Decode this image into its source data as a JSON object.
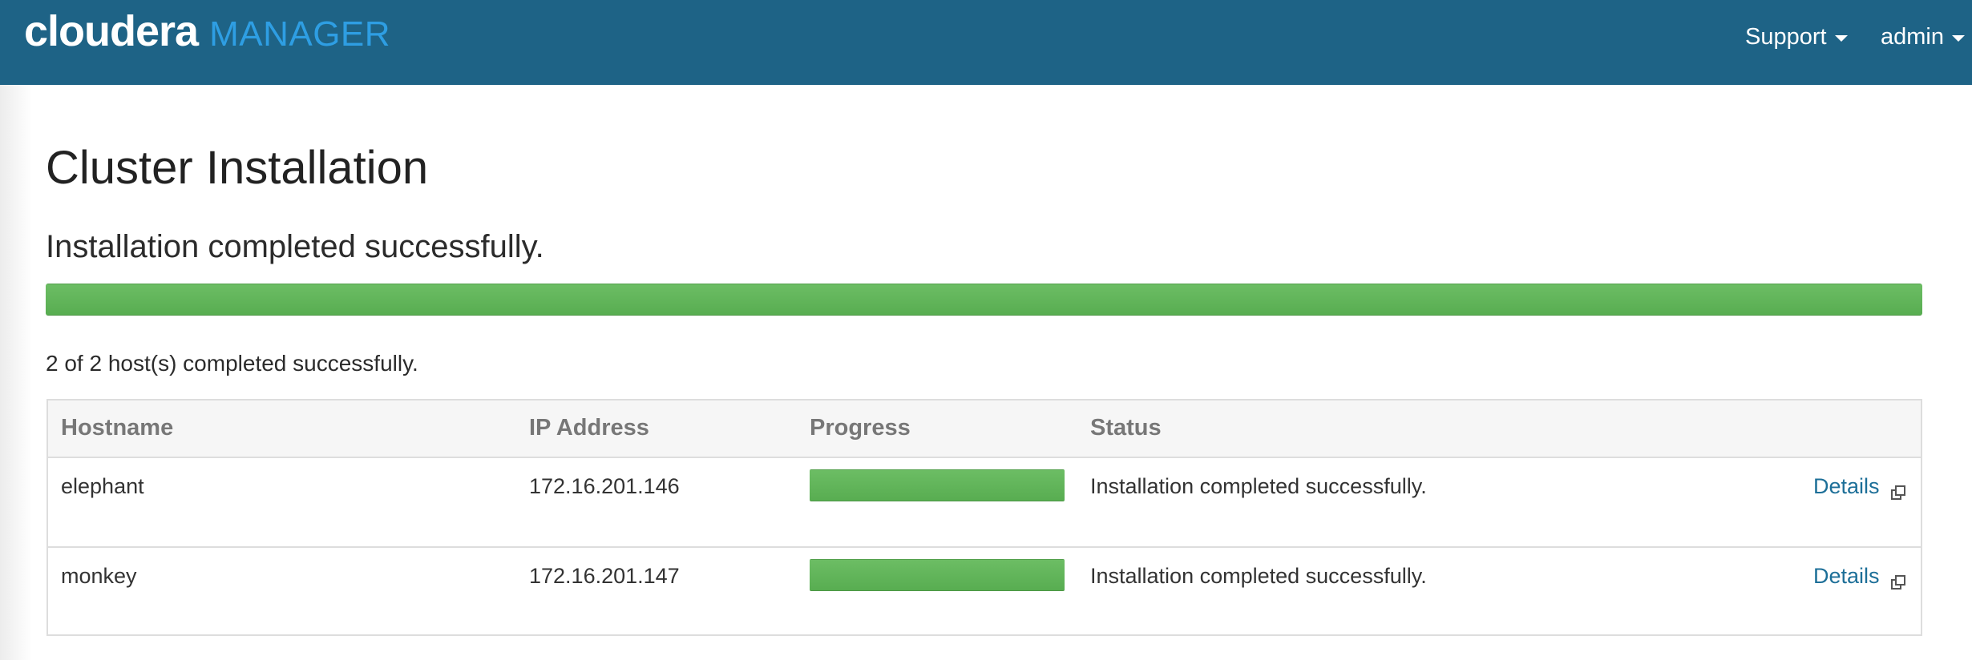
{
  "navbar": {
    "brand_primary": "cloudera",
    "brand_secondary": "MANAGER",
    "support_label": "Support",
    "admin_label": "admin"
  },
  "page": {
    "title": "Cluster Installation",
    "status_message": "Installation completed successfully.",
    "overall_progress": 1.0,
    "host_summary": "2 of 2 host(s) completed successfully."
  },
  "table": {
    "columns": [
      "Hostname",
      "IP Address",
      "Progress",
      "Status"
    ],
    "rows": [
      {
        "hostname": "elephant",
        "ip": "172.16.201.146",
        "progress": 1.0,
        "status": "Installation completed successfully.",
        "details_label": "Details"
      },
      {
        "hostname": "monkey",
        "ip": "172.16.201.147",
        "progress": 1.0,
        "status": "Installation completed successfully.",
        "details_label": "Details"
      }
    ]
  },
  "colors": {
    "navbar_bg": "#1e6386",
    "brand_accent": "#2e9ee3",
    "progress_green": "#5cb85c",
    "link": "#1d6f98"
  },
  "icons": {
    "details": "external-link-icon",
    "menu_caret": "caret-down-icon"
  }
}
